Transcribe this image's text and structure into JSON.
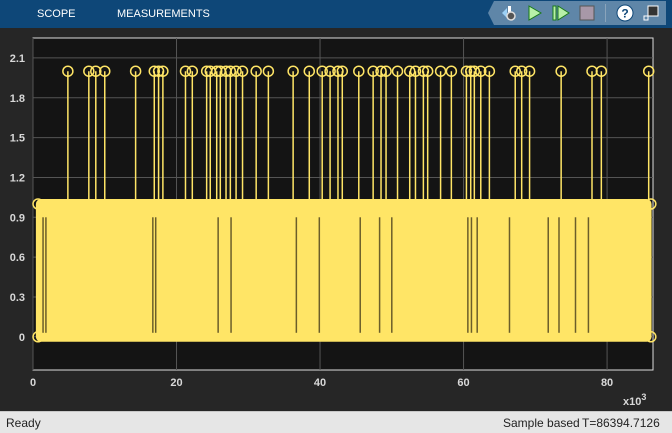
{
  "tabs": [
    {
      "label": "SCOPE"
    },
    {
      "label": "MEASUREMENTS"
    }
  ],
  "toolbar": {
    "icons": [
      "settings-icon",
      "run-icon",
      "step-forward-icon",
      "stop-icon",
      "help-icon",
      "undock-icon"
    ]
  },
  "status": {
    "left": "Ready",
    "mode": "Sample based",
    "time": "T=86394.7126"
  },
  "colors": {
    "line": "#ffe566",
    "plot_bg": "#141414",
    "header": "#0e4778"
  },
  "chart_data": {
    "type": "stem",
    "xlabel": "",
    "ylabel": "",
    "x_exponent_label": "x10",
    "x_exponent": "3",
    "xlim": [
      0,
      86.4
    ],
    "ylim": [
      -0.25,
      2.25
    ],
    "xticks": [
      0,
      20,
      40,
      60,
      80
    ],
    "xtick_labels": [
      "0",
      "20",
      "40",
      "60",
      "80"
    ],
    "yticks": [
      0,
      0.3,
      0.6,
      0.9,
      1.2,
      1.5,
      1.8,
      2.1
    ],
    "ytick_labels": [
      "0",
      "0.3",
      "0.6",
      "0.9",
      "1.2",
      "1.5",
      "1.8",
      "2.1"
    ],
    "grid": true,
    "base_level_values": [
      0,
      1
    ],
    "spikes_value": 2,
    "spike_times": [
      4.86,
      7.78,
      8.75,
      10.0,
      14.3,
      16.9,
      17.5,
      18.1,
      21.25,
      22.2,
      24.2,
      24.7,
      25.6,
      26.1,
      26.9,
      27.5,
      28.3,
      29.2,
      31.1,
      32.8,
      36.25,
      38.5,
      40.3,
      41.4,
      42.5,
      43.1,
      45.4,
      47.4,
      48.5,
      49.2,
      50.8,
      52.5,
      53.3,
      54.4,
      55.0,
      56.8,
      58.3,
      60.4,
      61.0,
      61.5,
      62.4,
      63.6,
      67.2,
      68.1,
      69.2,
      73.6,
      77.9,
      79.2,
      85.8
    ],
    "zero_gap_times": [
      1.4,
      1.8,
      16.7,
      17.1,
      25.8,
      27.6,
      36.7,
      39.9,
      45.6,
      48.3,
      50.0,
      60.6,
      61.1,
      61.9,
      66.4,
      71.8,
      73.3,
      75.6,
      77.4
    ]
  }
}
